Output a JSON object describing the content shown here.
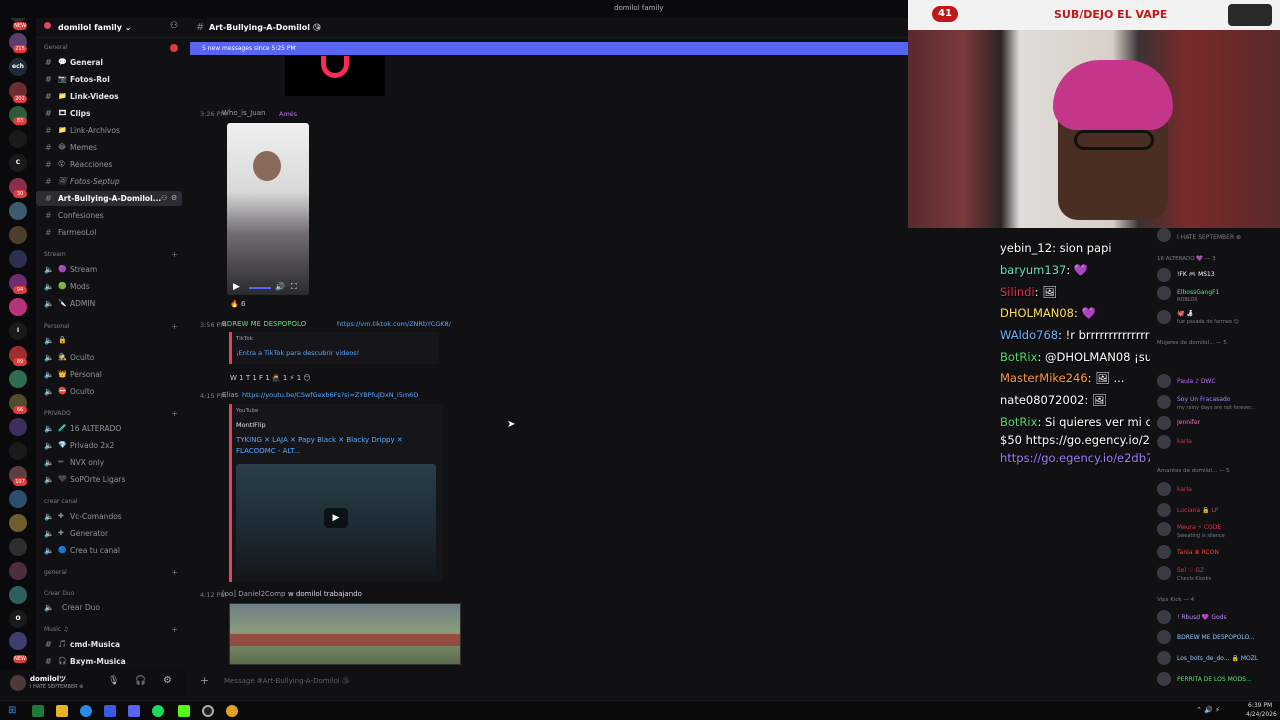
{
  "window_title": "domilol family",
  "server_rail": {
    "badges": [
      "NEW",
      "215",
      "202",
      "83",
      "30",
      "94",
      "89",
      "66",
      "107",
      "NEW"
    ],
    "letters": [
      "ech",
      "C",
      "I",
      "O"
    ]
  },
  "server": {
    "name": "domilol family ⌄"
  },
  "sidebar": {
    "groups": {
      "general": "General",
      "stream": "Stream",
      "personal": "Personal",
      "privado": "PRIVADO",
      "crear_canal": "crear canal",
      "general2": "general",
      "crear_duo": "Crear Duo",
      "music": "Music ♫"
    },
    "channels": [
      {
        "emoji": "💬",
        "label": "General",
        "bright": true
      },
      {
        "emoji": "📷",
        "label": "Fotos-Rol",
        "bright": true
      },
      {
        "emoji": "📁",
        "label": "Link-Videos",
        "bright": true
      },
      {
        "emoji": "🎞",
        "label": "Clips",
        "bright": true
      },
      {
        "emoji": "📁",
        "label": "Link-Archivos",
        "bright": false
      },
      {
        "emoji": "😂",
        "label": "Memes",
        "bright": false
      },
      {
        "emoji": "😮",
        "label": "Reacciones",
        "bright": false
      },
      {
        "emoji": "🖼",
        "label": "Fotos-Septup",
        "bright": false
      },
      {
        "emoji": "",
        "label": "Art-Bullying-A-Domilol...",
        "bright": true
      },
      {
        "emoji": "",
        "label": "Confesiones",
        "bright": false
      },
      {
        "emoji": "",
        "label": "FarmeoLol",
        "bright": false
      }
    ],
    "stream_channels": [
      {
        "emoji": "🟣",
        "label": "Stream"
      },
      {
        "emoji": "🟢",
        "label": "Mods"
      },
      {
        "emoji": "🔪",
        "label": "ADMIN"
      }
    ],
    "personal_channels": [
      {
        "emoji": "🔒",
        "label": ""
      },
      {
        "emoji": "🕵",
        "label": "Oculto"
      },
      {
        "emoji": "👑",
        "label": "Personal"
      },
      {
        "emoji": "⛔",
        "label": "Oculto"
      }
    ],
    "privado_channels": [
      {
        "emoji": "🧪",
        "label": "16 ALTERADO"
      },
      {
        "emoji": "💎",
        "label": "Privado 2x2"
      },
      {
        "emoji": "✏",
        "label": "NVX only"
      },
      {
        "emoji": "🖤",
        "label": "SoPOrte Ligars"
      }
    ],
    "crear_channels": [
      {
        "emoji": "✚",
        "label": "Vc-Comandos"
      },
      {
        "emoji": "✚",
        "label": "Generator"
      },
      {
        "emoji": "🔵",
        "label": "Crea tu canal"
      }
    ],
    "duo_channels": [
      {
        "emoji": "",
        "label": "Crear Duo"
      }
    ],
    "music_channels": [
      {
        "emoji": "🎵",
        "label": "cmd-Musica"
      },
      {
        "emoji": "🎧",
        "label": "Bxym-Musica"
      }
    ]
  },
  "user": {
    "name": "domilolツ",
    "status": "I HATE SEPTEMBER ⊗"
  },
  "chat": {
    "channel_name": "Art-Bullying-A-Domilol 😘",
    "new_messages_banner": "5 new messages since 5:25 PM",
    "messages": [
      {
        "time": "3:26 PM",
        "author": "Who_is_Juan",
        "tag": "Amés",
        "reaction": "🔥 6"
      },
      {
        "time": "3:56 PM",
        "author": "BDREW ME DESPOPOLO",
        "link": "https://vm.tiktok.com/ZNRbYCGK8/",
        "embed_provider": "TikTok",
        "embed_title": "¡Entra a TikTok para descubrir videos!",
        "reactions": "W 1   T 1   F 1   🥷 1   ⚡ 1   😶"
      },
      {
        "time": "4:15 PM",
        "author": "Elias",
        "link": "https://youtu.be/CSwfGexb6Fs?si=ZYBPfuJDxN_i5m6D",
        "embed_provider": "YouTube",
        "embed_channel": "MontIFlip",
        "embed_title": "TYKING ✕ LAJA ✕ Papy Black ✕ Blacky Drippy ✕ FLACOOMC - ALT..."
      },
      {
        "time": "4:12 PM",
        "author": "[oo] Daniel2Comp",
        "text": "w domilol trabajando"
      }
    ],
    "composer_placeholder": "Message #Art-Bullying-A-Domilol 😘"
  },
  "stream_overlay": {
    "viewer_count": "41",
    "banner": "SUB/DEJO EL VAPE"
  },
  "overlay_chat": [
    {
      "user": "yebin_12",
      "color": "#ffffff",
      "text": ": sion papi"
    },
    {
      "user": "baryum137",
      "color": "#62e7b5",
      "text": ": 💜"
    },
    {
      "user": "Silindi",
      "color": "#e0304a",
      "text": ": 🖼"
    },
    {
      "user": "DHOLMAN08",
      "color": "#ffe24a",
      "text": ": 💜"
    },
    {
      "user": "WAldo768",
      "color": "#66b3ff",
      "text": ": !r brrrrrrrrrrrrrrrrrrrrrrrrrrrrrrrrrr"
    },
    {
      "user": "BotRix",
      "color": "#4ddc6a",
      "text": ": @DHOLMAN08 ¡subiste al nivel 1!"
    },
    {
      "user": "MasterMike246",
      "color": "#ff9a3c",
      "text": ": 🖼 ..."
    },
    {
      "user": "nate08072002",
      "color": "#ffffff",
      "text": ": 🖼"
    },
    {
      "user": "BotRix",
      "color": "#4ddc6a",
      "text": ": Si quieres ver mi culo lleno e pelo entra"
    },
    {
      "user": "",
      "color": "#ffffff",
      "text": "$50 https://go.egency.io/2e05950e Bet now, get 100%"
    },
    {
      "user": "",
      "color": "#9d7bff",
      "text": "https://go.egency.io/e2db7588"
    }
  ],
  "members": {
    "top_status": "I HATE SEPTEMBER ⊗",
    "section_alterado": "16 ALTERADO 💜 — 3",
    "section_mujeres": "Mujeres de domilol... — 5",
    "section_amantes": "Amantes de domilol... — 5",
    "section_vips": "Vips Kick — 4",
    "list": [
      {
        "name": "!FK 🎮 MS13",
        "color": "#ffffff"
      },
      {
        "name": "ElbossGangF1",
        "color": "#62e07a",
        "sub": "ROBLOX"
      },
      {
        "name": "🐙 🍶",
        "color": "#ffffff",
        "sub": "fue pasada de farmeo 😏"
      },
      {
        "name": "Paula ♪ DWC",
        "color": "#c06bff"
      },
      {
        "name": "Soy Un Fracasado",
        "color": "#a980ff",
        "sub": "my rainy days are not forever..."
      },
      {
        "name": "Jennifer",
        "color": "#ff6bc8"
      },
      {
        "name": "karla",
        "color": "#e0304a"
      },
      {
        "name": "Luciana 🔒 LP",
        "color": "#e0304a"
      },
      {
        "name": "Meura ⚡ CODE",
        "color": "#e0304a",
        "sub": "Sweating is silence"
      },
      {
        "name": "Tania ♛ RCON",
        "color": "#ff3b3b"
      },
      {
        "name": "Sol ♡ GZ",
        "color": "#e0304a",
        "sub": "Chevis Kiosks"
      },
      {
        "name": "! Rbusd 💜 Gods",
        "color": "#b98cff"
      },
      {
        "name": "BDREW ME DESPOPOLO...",
        "color": "#8cc8ff"
      },
      {
        "name": "Los_bots_de_do... 🔒 MOZL",
        "color": "#8cc8ff"
      },
      {
        "name": "PERRITA DE LOS MODS...",
        "color": "#62e07a"
      }
    ]
  },
  "taskbar": {
    "time": "6:39 PM",
    "date": "4/24/2026"
  },
  "colors": {
    "accent": "#5865f2",
    "tiktok_embed": "#e0465f",
    "red_badge": "#e03a3a"
  }
}
